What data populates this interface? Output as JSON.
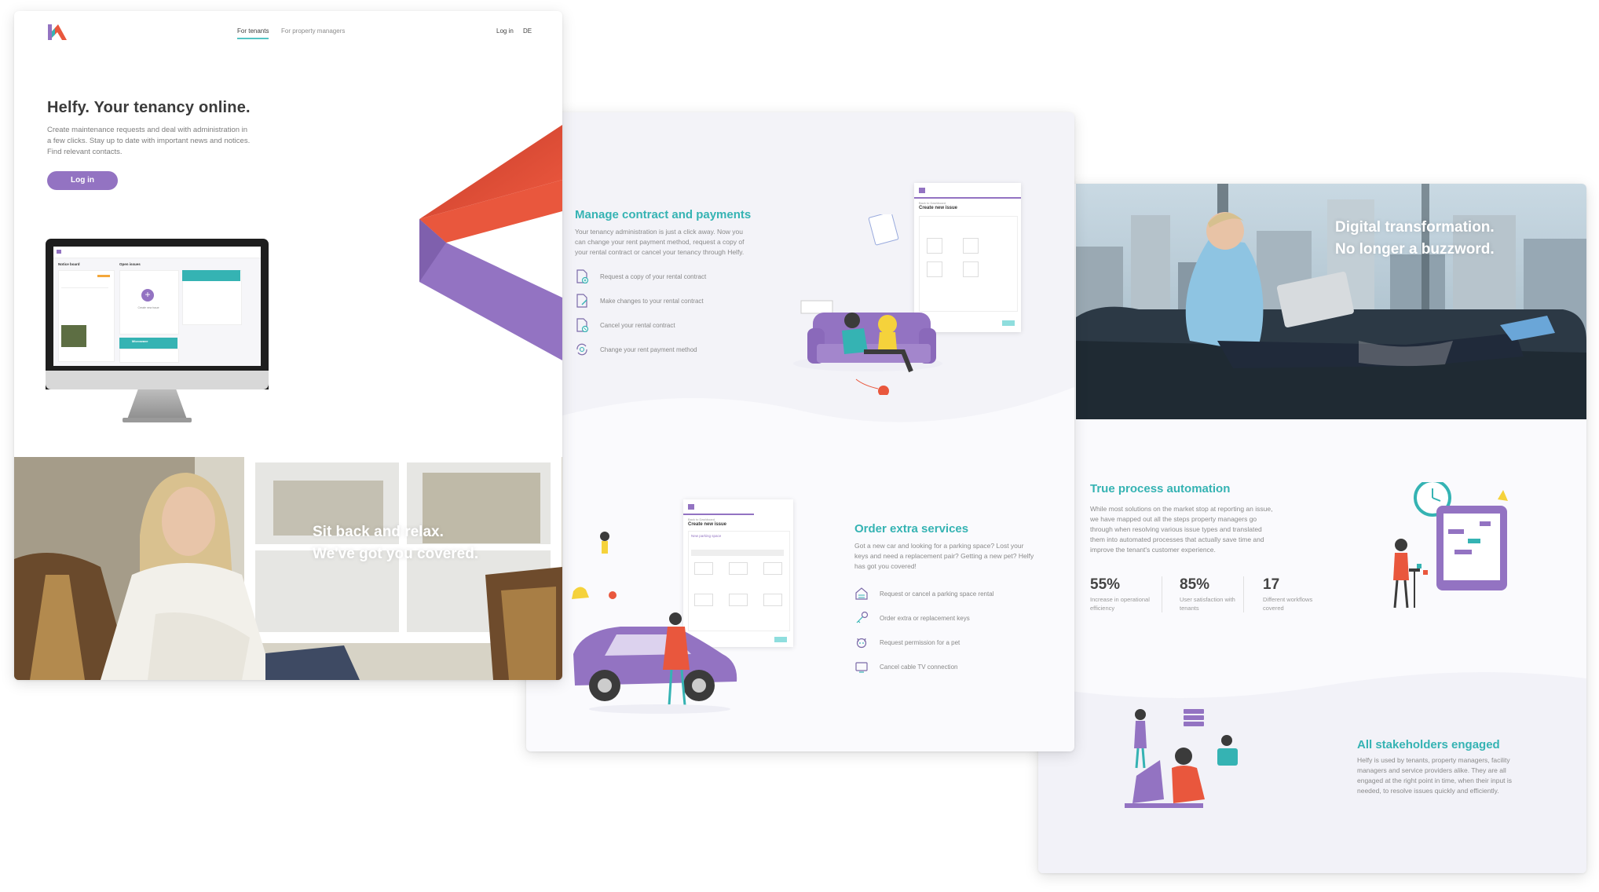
{
  "card1": {
    "nav": {
      "tenants": "For tenants",
      "managers": "For property managers",
      "login": "Log in",
      "lang": "DE"
    },
    "hero": {
      "title": "Helfy. Your tenancy online.",
      "text": "Create maintenance requests and deal with administration in a few clicks. Stay up to date with important news and notices. Find relevant contacts.",
      "button": "Log in"
    },
    "monitor": {
      "notice_board": "Notice board",
      "open_issues": "Open issues",
      "create_new_issue": "Create new issue",
      "microwave": "Microwave"
    },
    "photo_text": {
      "line1": "Sit back and relax.",
      "line2": "We've got you covered."
    }
  },
  "card2": {
    "contract": {
      "title": "Manage contract and payments",
      "text": "Your tenancy administration is just a click away. Now you can change your rent payment method, request a copy of your rental contract or cancel your tenancy through Helfy.",
      "items": [
        {
          "label": "Request a copy of your rental contract",
          "icon": "document-plus-icon"
        },
        {
          "label": "Make changes to your rental contract",
          "icon": "document-edit-icon"
        },
        {
          "label": "Cancel your rental contract",
          "icon": "document-cancel-icon"
        },
        {
          "label": "Change your rent payment method",
          "icon": "payment-cycle-icon"
        }
      ]
    },
    "form1": {
      "breadcrumb": "Back to Dashboard",
      "title": "Create new issue"
    },
    "services": {
      "title": "Order extra services",
      "text": "Got a new car and looking for a parking space? Lost your keys and need a replacement pair? Getting a new pet? Helfy has got you covered!",
      "items": [
        {
          "label": "Request or cancel a parking space rental",
          "icon": "garage-icon"
        },
        {
          "label": "Order extra or replacement keys",
          "icon": "key-icon"
        },
        {
          "label": "Request permission for a pet",
          "icon": "pet-icon"
        },
        {
          "label": "Cancel cable TV connection",
          "icon": "tv-icon"
        }
      ]
    },
    "form2": {
      "breadcrumb": "Back to Dashboard",
      "title": "Create new issue",
      "subtitle": "New parking space"
    }
  },
  "card3": {
    "photo_text": {
      "line1": "Digital transformation.",
      "line2": "No longer a buzzword."
    },
    "automation": {
      "title": "True process automation",
      "text": "While most solutions on the market stop at reporting an issue, we have mapped out all the steps property managers go through when resolving various issue types and translated them into automated processes that actually save time and improve the tenant's customer experience."
    },
    "stats": [
      {
        "value": "55%",
        "label": "Increase in operational efficiency"
      },
      {
        "value": "85%",
        "label": "User satisfaction with tenants"
      },
      {
        "value": "17",
        "label": "Different workflows covered"
      }
    ],
    "stakeholders": {
      "title": "All stakeholders engaged",
      "text": "Helfy is used by tenants, property managers, facility managers and service providers alike. They are all engaged at the right point in time, when their input is needed, to resolve issues quickly and efficiently."
    }
  },
  "colors": {
    "teal": "#35b3b3",
    "purple": "#9373c2",
    "orange": "#e9573d"
  }
}
